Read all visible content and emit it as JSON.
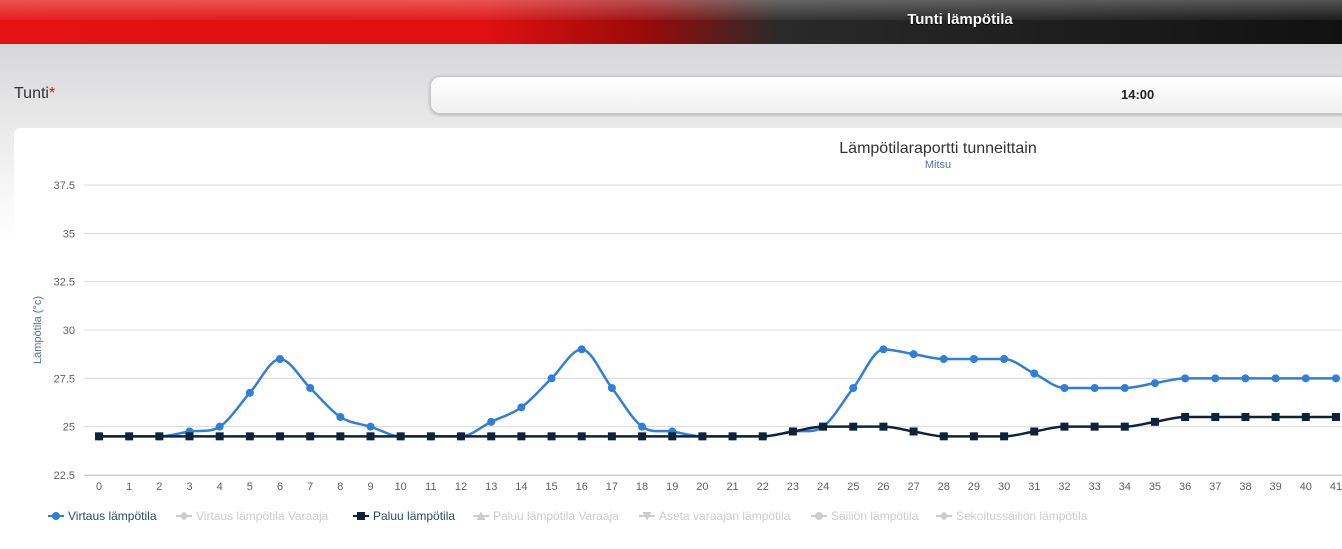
{
  "header": {
    "title": "Tunti lämpötila"
  },
  "form": {
    "field_label": "Tunti",
    "required_mark": "*",
    "selected_hour": "14:00"
  },
  "chart_data": {
    "type": "line",
    "title": "Lämpötilaraportti tunneittain",
    "subtitle": "Mitsu",
    "xlabel": "",
    "ylabel": "Lämpötila (°c)",
    "ylim": [
      22.5,
      37.5
    ],
    "yticks": [
      "22.5",
      "25",
      "27.5",
      "30",
      "32.5",
      "35",
      "37.5"
    ],
    "categories": [
      "0",
      "1",
      "2",
      "3",
      "4",
      "5",
      "6",
      "7",
      "8",
      "9",
      "10",
      "11",
      "12",
      "13",
      "14",
      "15",
      "16",
      "17",
      "18",
      "19",
      "20",
      "21",
      "22",
      "23",
      "24",
      "25",
      "26",
      "27",
      "28",
      "29",
      "30",
      "31",
      "32",
      "33",
      "34",
      "35",
      "36",
      "37",
      "38",
      "39",
      "40",
      "41"
    ],
    "grid": true,
    "legend_position": "bottom-left",
    "series": [
      {
        "name": "Virtaus lämpötila",
        "color": "#2f7ed8",
        "marker": "circle",
        "visible": true,
        "values": [
          24.5,
          24.5,
          24.5,
          24.75,
          25,
          26.75,
          28.5,
          27,
          25.5,
          25,
          24.5,
          24.5,
          24.5,
          25.25,
          26,
          27.5,
          29,
          27,
          25,
          24.75,
          24.5,
          24.5,
          24.5,
          24.75,
          25,
          27,
          29,
          28.75,
          28.5,
          28.5,
          28.5,
          27.75,
          27,
          27,
          27,
          27.25,
          27.5,
          27.5,
          27.5,
          27.5,
          27.5,
          27.5
        ]
      },
      {
        "name": "Virtaus lämpötila Varaaja",
        "color": "#cccccc",
        "marker": "diamond",
        "visible": false,
        "values": []
      },
      {
        "name": "Paluu lämpötila",
        "color": "#0d233a",
        "marker": "square",
        "visible": true,
        "values": [
          24.5,
          24.5,
          24.5,
          24.5,
          24.5,
          24.5,
          24.5,
          24.5,
          24.5,
          24.5,
          24.5,
          24.5,
          24.5,
          24.5,
          24.5,
          24.5,
          24.5,
          24.5,
          24.5,
          24.5,
          24.5,
          24.5,
          24.5,
          24.75,
          25,
          25,
          25,
          24.75,
          24.5,
          24.5,
          24.5,
          24.75,
          25,
          25,
          25,
          25.25,
          25.5,
          25.5,
          25.5,
          25.5,
          25.5,
          25.5
        ]
      },
      {
        "name": "Paluu lämpötila Varaaja",
        "color": "#cccccc",
        "marker": "triangle",
        "visible": false,
        "values": []
      },
      {
        "name": "Aseta varaajan lämpötila",
        "color": "#cccccc",
        "marker": "triangle-down",
        "visible": false,
        "values": []
      },
      {
        "name": "Säiliön lämpötila",
        "color": "#cccccc",
        "marker": "circle",
        "visible": false,
        "values": []
      },
      {
        "name": "Sekoitussäiliön lämpötila",
        "color": "#cccccc",
        "marker": "diamond",
        "visible": false,
        "values": []
      }
    ]
  }
}
